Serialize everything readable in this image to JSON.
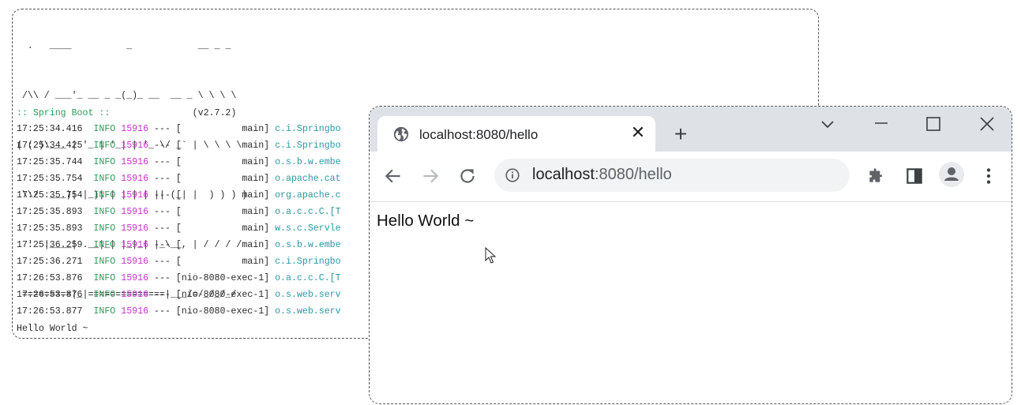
{
  "console": {
    "banner": [
      "  .   ____          _            __ _ _",
      " /\\\\ / ___'_ __ _ _(_)_ __  __ _ \\ \\ \\ \\",
      "( ( )\\___ | '_ | '_| | '_ \\/ _` | \\ \\ \\ \\",
      " \\\\/  ___)| |_)| | | | | || (_| |  ) ) ) )",
      "  '  |____| .__|_| |_|_| |_\\__, | / / / /",
      " =========|_|==============|___/=/_/_/_/"
    ],
    "boot_label": ":: Spring Boot ::",
    "boot_version": "(v2.7.2)",
    "logs": [
      {
        "time": "17:25:34.416",
        "level": "INFO",
        "pid": "15916",
        "sep": "---",
        "thread": "[           main]",
        "logger": "c.i.Springbo"
      },
      {
        "time": "17:25:34.425",
        "level": "INFO",
        "pid": "15916",
        "sep": "---",
        "thread": "[           main]",
        "logger": "c.i.Springbo"
      },
      {
        "time": "17:25:35.744",
        "level": "INFO",
        "pid": "15916",
        "sep": "---",
        "thread": "[           main]",
        "logger": "o.s.b.w.embe"
      },
      {
        "time": "17:25:35.754",
        "level": "INFO",
        "pid": "15916",
        "sep": "---",
        "thread": "[           main]",
        "logger": "o.apache.cat"
      },
      {
        "time": "17:25:35.754",
        "level": "INFO",
        "pid": "15916",
        "sep": "---",
        "thread": "[           main]",
        "logger": "org.apache.c"
      },
      {
        "time": "17:25:35.893",
        "level": "INFO",
        "pid": "15916",
        "sep": "---",
        "thread": "[           main]",
        "logger": "o.a.c.c.C.[T"
      },
      {
        "time": "17:25:35.893",
        "level": "INFO",
        "pid": "15916",
        "sep": "---",
        "thread": "[           main]",
        "logger": "w.s.c.Servle"
      },
      {
        "time": "17:25:36.259",
        "level": "INFO",
        "pid": "15916",
        "sep": "---",
        "thread": "[           main]",
        "logger": "o.s.b.w.embe"
      },
      {
        "time": "17:25:36.271",
        "level": "INFO",
        "pid": "15916",
        "sep": "---",
        "thread": "[           main]",
        "logger": "c.i.Springbo"
      },
      {
        "time": "17:26:53.876",
        "level": "INFO",
        "pid": "15916",
        "sep": "---",
        "thread": "[nio-8080-exec-1]",
        "logger": "o.a.c.c.C.[T"
      },
      {
        "time": "17:26:53.876",
        "level": "INFO",
        "pid": "15916",
        "sep": "---",
        "thread": "[nio-8080-exec-1]",
        "logger": "o.s.web.serv"
      },
      {
        "time": "17:26:53.877",
        "level": "INFO",
        "pid": "15916",
        "sep": "---",
        "thread": "[nio-8080-exec-1]",
        "logger": "o.s.web.serv"
      }
    ],
    "output": "Hello World ~"
  },
  "browser": {
    "tab_title": "localhost:8080/hello",
    "tab_close": "✕",
    "new_tab": "+",
    "url_host": "localhost",
    "url_rest": ":8080/hello",
    "page_text": "Hello World ~"
  },
  "colors": {
    "level": "#2f9a5a",
    "pid": "#c236c4",
    "logger": "#2b98a4",
    "tabbar": "#dee1e6",
    "omnibox": "#f1f3f4"
  },
  "icons": [
    "globe-icon",
    "close-icon",
    "plus-icon",
    "chevron-down-icon",
    "minimize-icon",
    "maximize-icon",
    "window-close-icon",
    "back-arrow-icon",
    "forward-arrow-icon",
    "reload-icon",
    "info-icon",
    "extensions-icon",
    "side-panel-icon",
    "profile-icon",
    "more-vert-icon",
    "mouse-cursor-icon"
  ]
}
